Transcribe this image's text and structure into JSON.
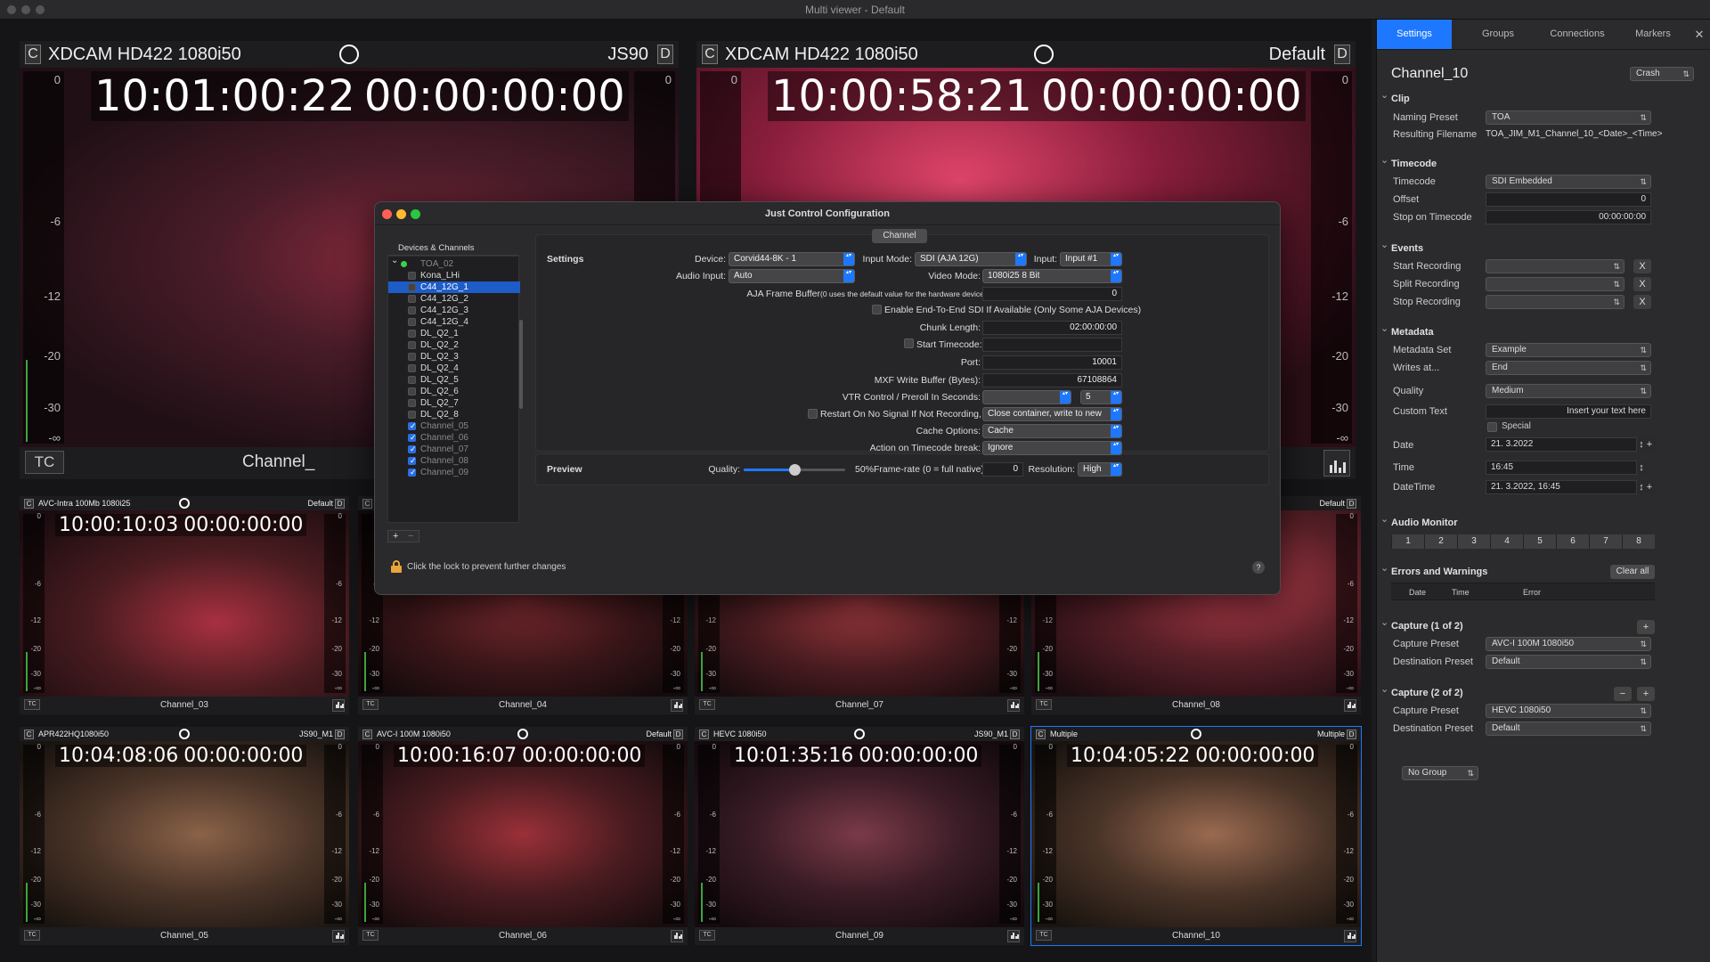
{
  "window": {
    "title": "Multi viewer - Default"
  },
  "meter_marks": [
    "0",
    "-6",
    "-12",
    "-20",
    "-30",
    "-∞"
  ],
  "tiles": {
    "big1": {
      "codec": "XDCAM HD422 1080i50",
      "group": "JS90",
      "tc1": "10:01:00:22",
      "tc2": "00:00:00:00",
      "channel": "Channel_"
    },
    "big2": {
      "codec": "XDCAM HD422 1080i50",
      "group": "Default",
      "tc1": "10:00:58:21",
      "tc2": "00:00:00:00",
      "channel": ""
    },
    "t1": {
      "codec": "AVC-Intra 100Mb 1080i25",
      "group": "Default",
      "tc1": "10:00:10:03",
      "tc2": "00:00:00:00",
      "channel": "Channel_03"
    },
    "t2": {
      "codec": "",
      "group": "",
      "tc1": "",
      "tc2": "",
      "channel": "Channel_04"
    },
    "t3": {
      "codec": "",
      "group": "",
      "tc1": "",
      "tc2": "",
      "channel": "Channel_07"
    },
    "t4": {
      "codec": "",
      "group": "Default",
      "tc1": "",
      "tc2": "00",
      "channel": "Channel_08"
    },
    "t5": {
      "codec": "APR422HQ1080i50",
      "group": "JS90_M1",
      "tc1": "10:04:08:06",
      "tc2": "00:00:00:00",
      "channel": "Channel_05"
    },
    "t6": {
      "codec": "AVC-I 100M 1080i50",
      "group": "Default",
      "tc1": "10:00:16:07",
      "tc2": "00:00:00:00",
      "channel": "Channel_06"
    },
    "t7": {
      "codec": "HEVC 1080i50",
      "group": "JS90_M1",
      "tc1": "10:01:35:16",
      "tc2": "00:00:00:00",
      "channel": "Channel_09"
    },
    "t8": {
      "codec": "Multiple",
      "group": "Multiple",
      "tc1": "10:04:05:22",
      "tc2": "00:00:00:00",
      "channel": "Channel_10"
    }
  },
  "labels": {
    "c": "C",
    "d": "D",
    "tc": "TC"
  },
  "side": {
    "tabs": [
      "Settings",
      "Groups",
      "Connections",
      "Markers"
    ],
    "close": "✕",
    "channel_name": "Channel_10",
    "crash": "Crash",
    "clip": {
      "title": "Clip",
      "naming_label": "Naming Preset",
      "naming": "TOA",
      "resulting_label": "Resulting Filename",
      "resulting": "TOA_JIM_M1_Channel_10_<Date>_<Time>"
    },
    "timecode": {
      "title": "Timecode",
      "tc_label": "Timecode",
      "tc": "SDI Embedded",
      "offset_label": "Offset",
      "offset": "0",
      "stop_label": "Stop on Timecode",
      "stop": "00:00:00:00"
    },
    "events": {
      "title": "Events",
      "start": "Start Recording",
      "split": "Split Recording",
      "stop": "Stop Recording",
      "x": "X"
    },
    "metadata": {
      "title": "Metadata",
      "set_label": "Metadata Set",
      "set": "Example",
      "writes_label": "Writes at...",
      "writes": "End",
      "quality_label": "Quality",
      "quality": "Medium",
      "custom_label": "Custom Text",
      "custom": "Insert your text here",
      "special": "Special",
      "date_label": "Date",
      "date": "21. 3.2022",
      "time_label": "Time",
      "time": "16:45",
      "datetime_label": "DateTime",
      "datetime": "21. 3.2022,  16:45"
    },
    "audio": {
      "title": "Audio Monitor",
      "channels": [
        "1",
        "2",
        "3",
        "4",
        "5",
        "6",
        "7",
        "8"
      ]
    },
    "errors": {
      "title": "Errors and Warnings",
      "clear": "Clear all",
      "cols": [
        "Date",
        "Time",
        "Error"
      ]
    },
    "cap1": {
      "title": "Capture (1 of 2)",
      "preset_label": "Capture Preset",
      "preset": "AVC-I 100M 1080i50",
      "dest_label": "Destination Preset",
      "dest": "Default"
    },
    "cap2": {
      "title": "Capture (2 of 2)",
      "preset_label": "Capture Preset",
      "preset": "HEVC 1080i50",
      "dest_label": "Destination Preset",
      "dest": "Default"
    },
    "plus": "+",
    "minus": "−",
    "group": "No Group"
  },
  "dialog": {
    "title": "Just Control Configuration",
    "devices_header": "Devices & Channels",
    "devices": [
      {
        "name": "TOA_02",
        "root": true
      },
      {
        "name": "Kona_LHi",
        "checked": false
      },
      {
        "name": "C44_12G_1",
        "checked": false,
        "selected": true
      },
      {
        "name": "C44_12G_2",
        "checked": false
      },
      {
        "name": "C44_12G_3",
        "checked": false
      },
      {
        "name": "C44_12G_4",
        "checked": false
      },
      {
        "name": "DL_Q2_1",
        "checked": false
      },
      {
        "name": "DL_Q2_2",
        "checked": false
      },
      {
        "name": "DL_Q2_3",
        "checked": false
      },
      {
        "name": "DL_Q2_4",
        "checked": false
      },
      {
        "name": "DL_Q2_5",
        "checked": false
      },
      {
        "name": "DL_Q2_6",
        "checked": false
      },
      {
        "name": "DL_Q2_7",
        "checked": false
      },
      {
        "name": "DL_Q2_8",
        "checked": false
      },
      {
        "name": "Channel_05",
        "checked": true
      },
      {
        "name": "Channel_06",
        "checked": true
      },
      {
        "name": "Channel_07",
        "checked": true
      },
      {
        "name": "Channel_08",
        "checked": true
      },
      {
        "name": "Channel_09",
        "checked": true
      }
    ],
    "channel_tab": "Channel",
    "settings": "Settings",
    "device_label": "Device:",
    "device": "Corvid44-8K - 1",
    "inputmode_label": "Input Mode:",
    "inputmode": "SDI (AJA 12G)",
    "input_label": "Input:",
    "input": "Input #1",
    "audio_label": "Audio Input:",
    "audio": "Auto",
    "videomode_label": "Video Mode:",
    "videomode": "1080i25 8 Bit",
    "framebuf_label": "AJA Frame Buffer",
    "framebuf_note": "(0 uses the default value for the hardware device)",
    "framebuf": "0",
    "e2e": "Enable End-To-End SDI If Available (Only Some AJA Devices)",
    "chunk_label": "Chunk Length:",
    "chunk": "02:00:00:00",
    "starttc": "Start Timecode:",
    "port_label": "Port:",
    "port": "10001",
    "mxf_label": "MXF Write Buffer (Bytes):",
    "mxf": "67108864",
    "vtr_label": "VTR Control / Preroll In Seconds:",
    "vtr": "5",
    "restart": "Restart On No Signal If Not Recording, Or:",
    "restart_opt": "Close container, write to new",
    "cache_label": "Cache Options:",
    "cache": "Cache",
    "tcbreak_label": "Action on Timecode break:",
    "tcbreak": "Ignore",
    "preview": "Preview",
    "quality_label": "Quality:",
    "quality_pct": "50%",
    "framerate_label": "Frame-rate (0 = full native):",
    "framerate": "0",
    "resolution_label": "Resolution:",
    "resolution": "High",
    "lock_text": "Click the lock to prevent further changes",
    "help": "?",
    "add": "+",
    "remove": "−",
    "slider_value": 0.5
  }
}
